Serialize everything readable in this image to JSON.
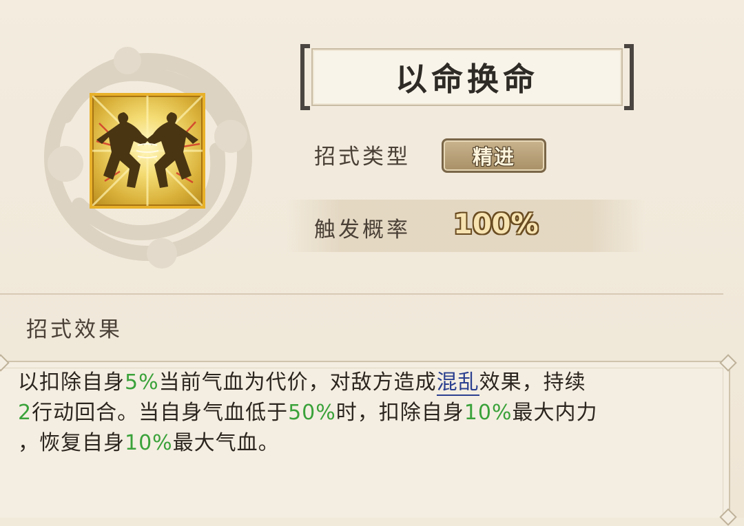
{
  "skill": {
    "name": "以命换命",
    "icon": "dueling-fighters-icon",
    "type_label": "招式类型",
    "type_value": "精进",
    "rate_label": "触发概率",
    "rate_value": "100%"
  },
  "effect": {
    "heading": "招式效果",
    "line1": {
      "t1": "以扣除自身",
      "n1": "5%",
      "t2": "当前气血为代价，对敌方造成",
      "link": "混乱",
      "t3": "效果，持续"
    },
    "line2": {
      "n1": "2",
      "t1": "行动回合。当自身气血低于",
      "n2": "50%",
      "t2": "时，扣除自身",
      "n3": "10%",
      "t3": "最大内力"
    },
    "line3": {
      "t1": "，恢复自身",
      "n1": "10%",
      "t2": "最大气血。"
    }
  },
  "colors": {
    "background": "#f1e9da",
    "highlight_green": "#3aa23a",
    "highlight_blue": "#2a3f8f",
    "icon_frame": "#e8b12a"
  }
}
